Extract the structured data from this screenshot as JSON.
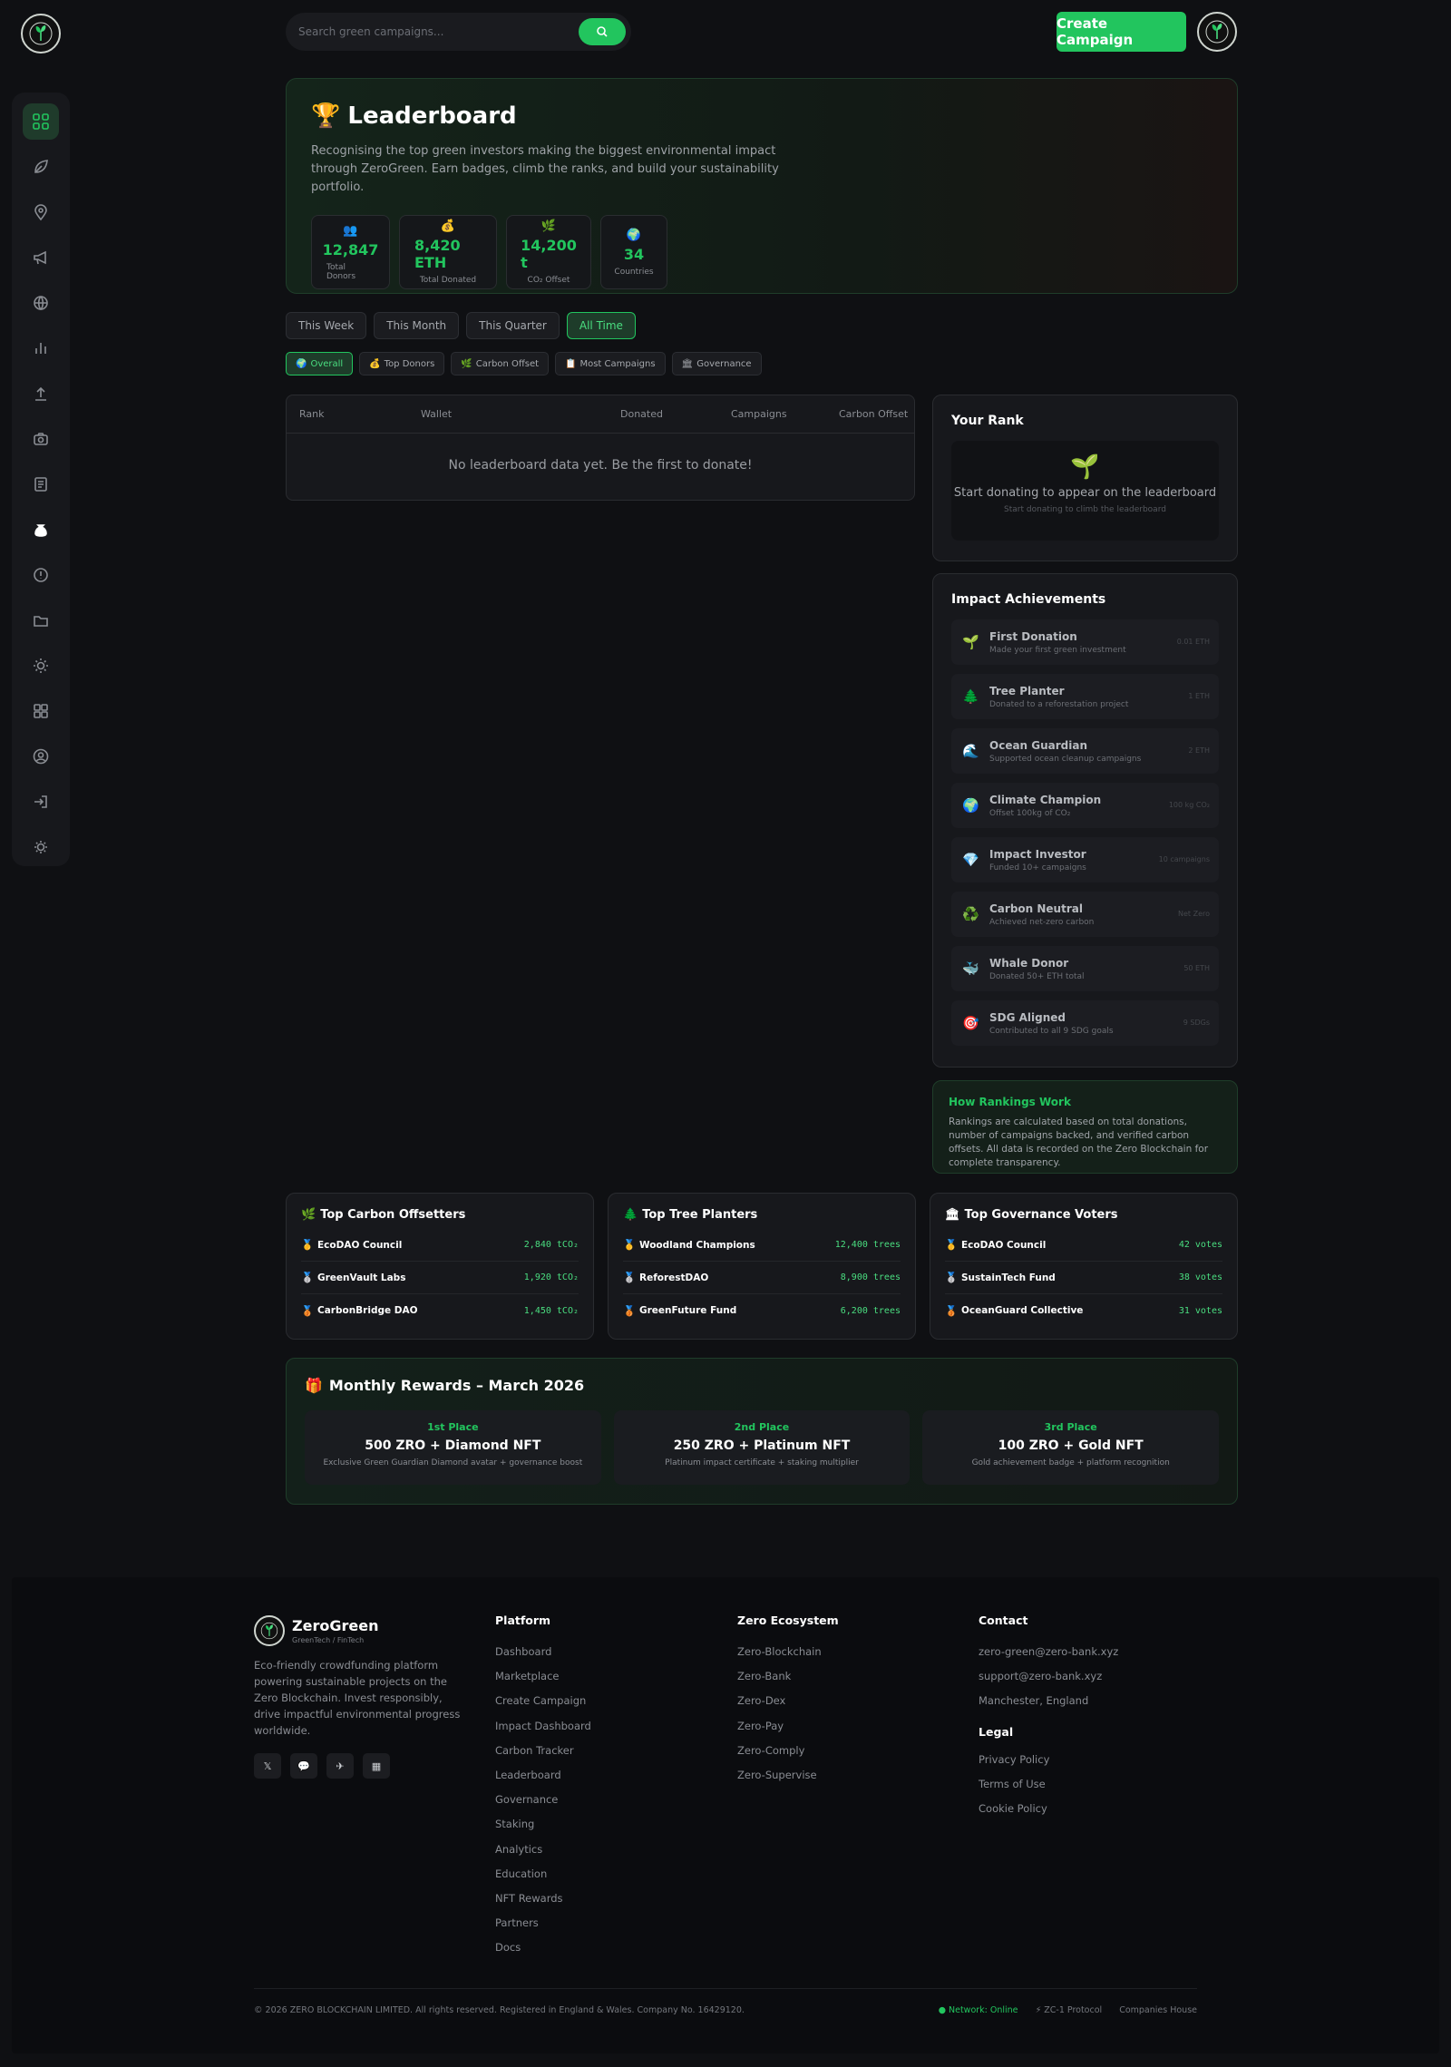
{
  "header": {
    "search_placeholder": "Search green campaigns...",
    "create_label": "Create Campaign"
  },
  "sidebar": {
    "items": [
      "dashboard",
      "leaf",
      "location",
      "megaphone",
      "globe",
      "analytics",
      "upload",
      "camera",
      "receipt",
      "moneybag",
      "info",
      "folder",
      "sun",
      "grid",
      "user",
      "login",
      "theme"
    ]
  },
  "hero": {
    "title": "Leaderboard",
    "description": "Recognising the top green investors making the biggest environmental impact through ZeroGreen. Earn badges, climb the ranks, and build your sustainability portfolio.",
    "stats": [
      {
        "icon": "👥",
        "value": "12,847",
        "label": "Total Donors"
      },
      {
        "icon": "💰",
        "value": "8,420 ETH",
        "label": "Total Donated"
      },
      {
        "icon": "🌿",
        "value": "14,200 t",
        "label": "CO₂ Offset"
      },
      {
        "icon": "🌍",
        "value": "34",
        "label": "Countries"
      }
    ]
  },
  "time_tabs": [
    "This Week",
    "This Month",
    "This Quarter",
    "All Time"
  ],
  "category_tabs": [
    {
      "icon": "🌍",
      "label": "Overall"
    },
    {
      "icon": "💰",
      "label": "Top Donors"
    },
    {
      "icon": "🌿",
      "label": "Carbon Offset"
    },
    {
      "icon": "📋",
      "label": "Most Campaigns"
    },
    {
      "icon": "🏛",
      "label": "Governance"
    }
  ],
  "table": {
    "columns": [
      "Rank",
      "Wallet",
      "Donated",
      "Campaigns",
      "Carbon Offset"
    ],
    "empty": "No leaderboard data yet. Be the first to donate!"
  },
  "your_rank": {
    "title": "Your Rank",
    "message": "Start donating to appear on the leaderboard",
    "sub": "Start donating to climb the leaderboard"
  },
  "achievements": {
    "title": "Impact Achievements",
    "items": [
      {
        "icon": "🌱",
        "name": "First Donation",
        "desc": "Made your first green investment",
        "req": "0.01 ETH"
      },
      {
        "icon": "🌲",
        "name": "Tree Planter",
        "desc": "Donated to a reforestation project",
        "req": "1 ETH"
      },
      {
        "icon": "🌊",
        "name": "Ocean Guardian",
        "desc": "Supported ocean cleanup campaigns",
        "req": "2 ETH"
      },
      {
        "icon": "🌍",
        "name": "Climate Champion",
        "desc": "Offset 100kg of CO₂",
        "req": "100 kg CO₂"
      },
      {
        "icon": "💎",
        "name": "Impact Investor",
        "desc": "Funded 10+ campaigns",
        "req": "10 campaigns"
      },
      {
        "icon": "♻️",
        "name": "Carbon Neutral",
        "desc": "Achieved net-zero carbon",
        "req": "Net Zero"
      },
      {
        "icon": "🐳",
        "name": "Whale Donor",
        "desc": "Donated 50+ ETH total",
        "req": "50 ETH"
      },
      {
        "icon": "🎯",
        "name": "SDG Aligned",
        "desc": "Contributed to all 9 SDG goals",
        "req": "9 SDGs"
      }
    ]
  },
  "how": {
    "title": "How Rankings Work",
    "text": "Rankings are calculated based on total donations, number of campaigns backed, and verified carbon offsets. All data is recorded on the Zero Blockchain for complete transparency."
  },
  "top_lists": [
    {
      "icon": "🌿",
      "title": "Top Carbon Offsetters",
      "rows": [
        {
          "medal": "🥇",
          "name": "EcoDAO Council",
          "value": "2,840 tCO₂"
        },
        {
          "medal": "🥈",
          "name": "GreenVault Labs",
          "value": "1,920 tCO₂"
        },
        {
          "medal": "🥉",
          "name": "CarbonBridge DAO",
          "value": "1,450 tCO₂"
        }
      ]
    },
    {
      "icon": "🌲",
      "title": "Top Tree Planters",
      "rows": [
        {
          "medal": "🥇",
          "name": "Woodland Champions",
          "value": "12,400 trees"
        },
        {
          "medal": "🥈",
          "name": "ReforestDAO",
          "value": "8,900 trees"
        },
        {
          "medal": "🥉",
          "name": "GreenFuture Fund",
          "value": "6,200 trees"
        }
      ]
    },
    {
      "icon": "🏛",
      "title": "Top Governance Voters",
      "rows": [
        {
          "medal": "🥇",
          "name": "EcoDAO Council",
          "value": "42 votes"
        },
        {
          "medal": "🥈",
          "name": "SustainTech Fund",
          "value": "38 votes"
        },
        {
          "medal": "🥉",
          "name": "OceanGuard Collective",
          "value": "31 votes"
        }
      ]
    }
  ],
  "rewards": {
    "title": "Monthly Rewards – March 2026",
    "items": [
      {
        "place": "1st Place",
        "prize": "500 ZRO + Diamond NFT",
        "desc": "Exclusive Green Guardian Diamond avatar + governance boost"
      },
      {
        "place": "2nd Place",
        "prize": "250 ZRO + Platinum NFT",
        "desc": "Platinum impact certificate + staking multiplier"
      },
      {
        "place": "3rd Place",
        "prize": "100 ZRO + Gold NFT",
        "desc": "Gold achievement badge + platform recognition"
      }
    ]
  },
  "footer": {
    "brand": "ZeroGreen",
    "tagline": "GreenTech / FinTech",
    "about": "Eco-friendly crowdfunding platform powering sustainable projects on the Zero Blockchain. Invest responsibly, drive impactful environmental progress worldwide.",
    "socials": [
      "𝕏",
      "💬",
      "✈",
      "▦"
    ],
    "platform_title": "Platform",
    "platform": [
      "Dashboard",
      "Marketplace",
      "Create Campaign",
      "Impact Dashboard",
      "Carbon Tracker",
      "Leaderboard",
      "Governance",
      "Staking",
      "Analytics",
      "Education",
      "NFT Rewards",
      "Partners",
      "Docs"
    ],
    "eco_title": "Zero Ecosystem",
    "eco": [
      "Zero-Blockchain",
      "Zero-Bank",
      "Zero-Dex",
      "Zero-Pay",
      "Zero-Comply",
      "Zero-Supervise"
    ],
    "contact_title": "Contact",
    "contact": [
      "zero-green@zero-bank.xyz",
      "support@zero-bank.xyz",
      "Manchester, England"
    ],
    "legal_title": "Legal",
    "legal": [
      "Privacy Policy",
      "Terms of Use",
      "Cookie Policy"
    ],
    "copyright": "© 2026 ZERO BLOCKCHAIN LIMITED. All rights reserved. Registered in England & Wales. Company No. 16429120.",
    "status": "● Network: Online",
    "protocol": "⚡ ZC-1 Protocol",
    "house": "Companies House"
  },
  "colors": {
    "accent": "#22c55e",
    "background": "#0f1013",
    "card": "#17181c"
  }
}
